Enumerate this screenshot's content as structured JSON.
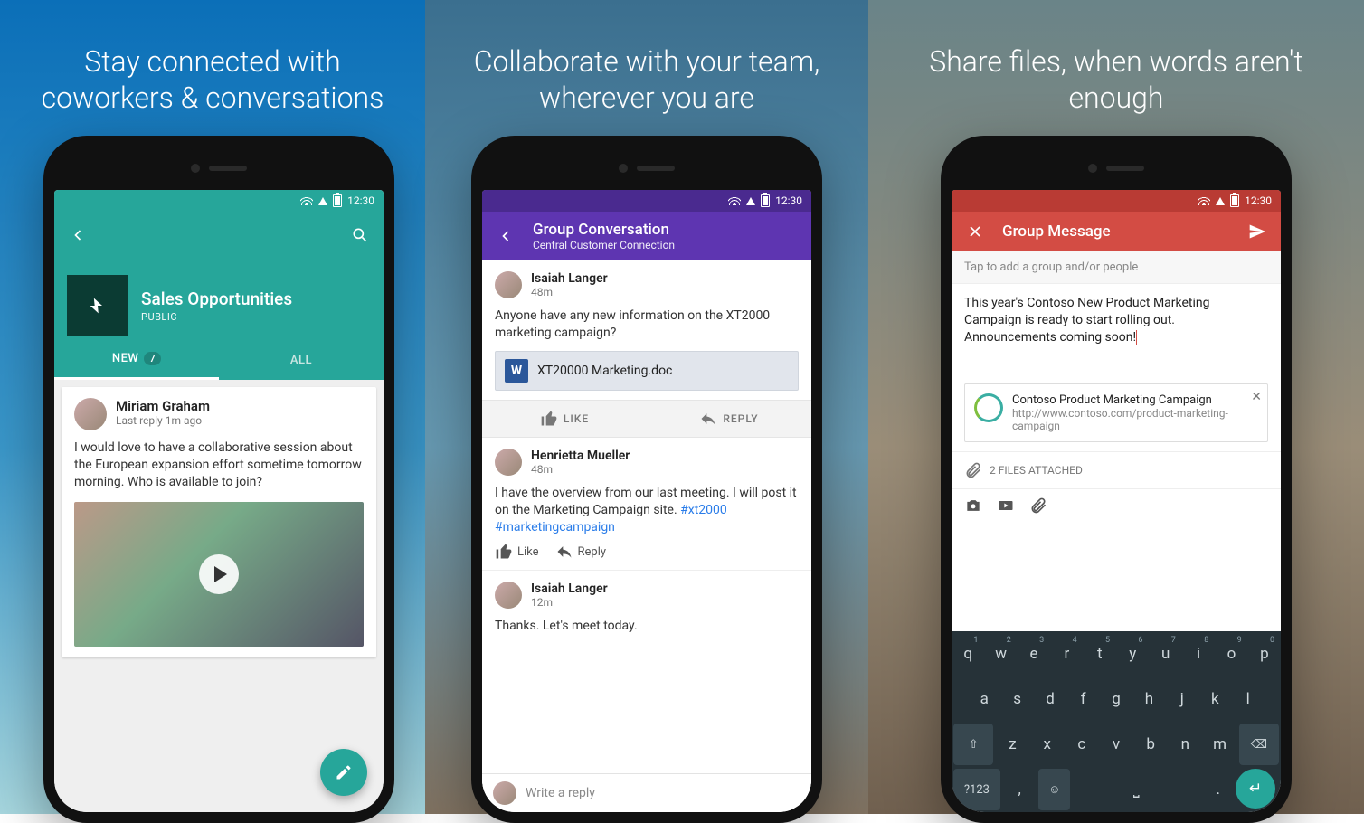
{
  "status_time": "12:30",
  "panel1": {
    "headline": "Stay connected with coworkers & conversations",
    "group_name": "Sales Opportunities",
    "visibility": "PUBLIC",
    "tabs": {
      "new": "NEW",
      "new_count": "7",
      "all": "ALL"
    },
    "post": {
      "author": "Miriam Graham",
      "meta": "Last reply 1m ago",
      "text": "I would love to have a collaborative session about the European expansion effort sometime tomorrow morning. Who is available to join?"
    }
  },
  "panel2": {
    "headline": "Collaborate with your team, wherever you are",
    "title": "Group Conversation",
    "subtitle": "Central Customer Connection",
    "post1": {
      "author": "Isaiah Langer",
      "meta": "48m",
      "text": "Anyone have any new information on the XT2000 marketing campaign?",
      "file": "XT20000 Marketing.doc"
    },
    "actions": {
      "like": "LIKE",
      "reply": "REPLY"
    },
    "post2": {
      "author": "Henrietta Mueller",
      "meta": "48m",
      "text_a": "I have the overview from our last meeting. I will post it on the Marketing Campaign site. ",
      "text_b": "#xt2000 #marketingcampaign"
    },
    "inline": {
      "like": "Like",
      "reply": "Reply"
    },
    "post3": {
      "author": "Isaiah Langer",
      "meta": "12m",
      "text": "Thanks. Let's meet today."
    },
    "reply_placeholder": "Write a reply"
  },
  "panel3": {
    "headline": "Share files, when words aren't enough",
    "title": "Group Message",
    "recipients_placeholder": "Tap to add a group and/or people",
    "compose": "This year's Contoso New Product Marketing Campaign is ready to start rolling out. Announcements coming soon!",
    "link": {
      "title": "Contoso Product Marketing Campaign",
      "url": "http://www.contoso.com/product-marketing-campaign"
    },
    "attached": "2 FILES ATTACHED",
    "keyboard": {
      "row1": [
        "q",
        "w",
        "e",
        "r",
        "t",
        "y",
        "u",
        "i",
        "o",
        "p"
      ],
      "row1_sup": [
        "1",
        "2",
        "3",
        "4",
        "5",
        "6",
        "7",
        "8",
        "9",
        "0"
      ],
      "row2": [
        "a",
        "s",
        "d",
        "f",
        "g",
        "h",
        "j",
        "k",
        "l"
      ],
      "row3": [
        "z",
        "x",
        "c",
        "v",
        "b",
        "n",
        "m"
      ],
      "sym": "?123",
      "comma": ",",
      "period": "."
    }
  }
}
